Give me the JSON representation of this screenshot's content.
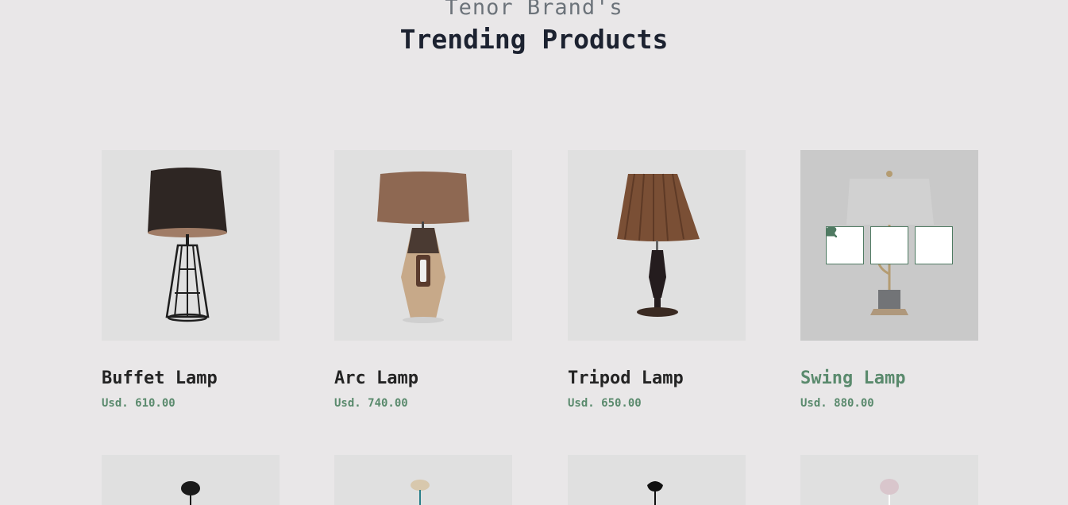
{
  "header": {
    "subtitle": "Tenor Brand's",
    "title": "Trending Products"
  },
  "products": [
    {
      "name": "Buffet Lamp",
      "price": "Usd. 610.00"
    },
    {
      "name": "Arc Lamp",
      "price": "Usd. 740.00"
    },
    {
      "name": "Tripod Lamp",
      "price": "Usd. 650.00"
    },
    {
      "name": "Swing Lamp",
      "price": "Usd. 880.00",
      "hovered": true
    }
  ],
  "actions": [
    "search-icon",
    "heart-icon",
    "bag-icon"
  ],
  "colors": {
    "background": "#e9e7e8",
    "accent": "#5a8a6d",
    "title": "#1c2230",
    "card_bg": "#e0e0e0"
  }
}
